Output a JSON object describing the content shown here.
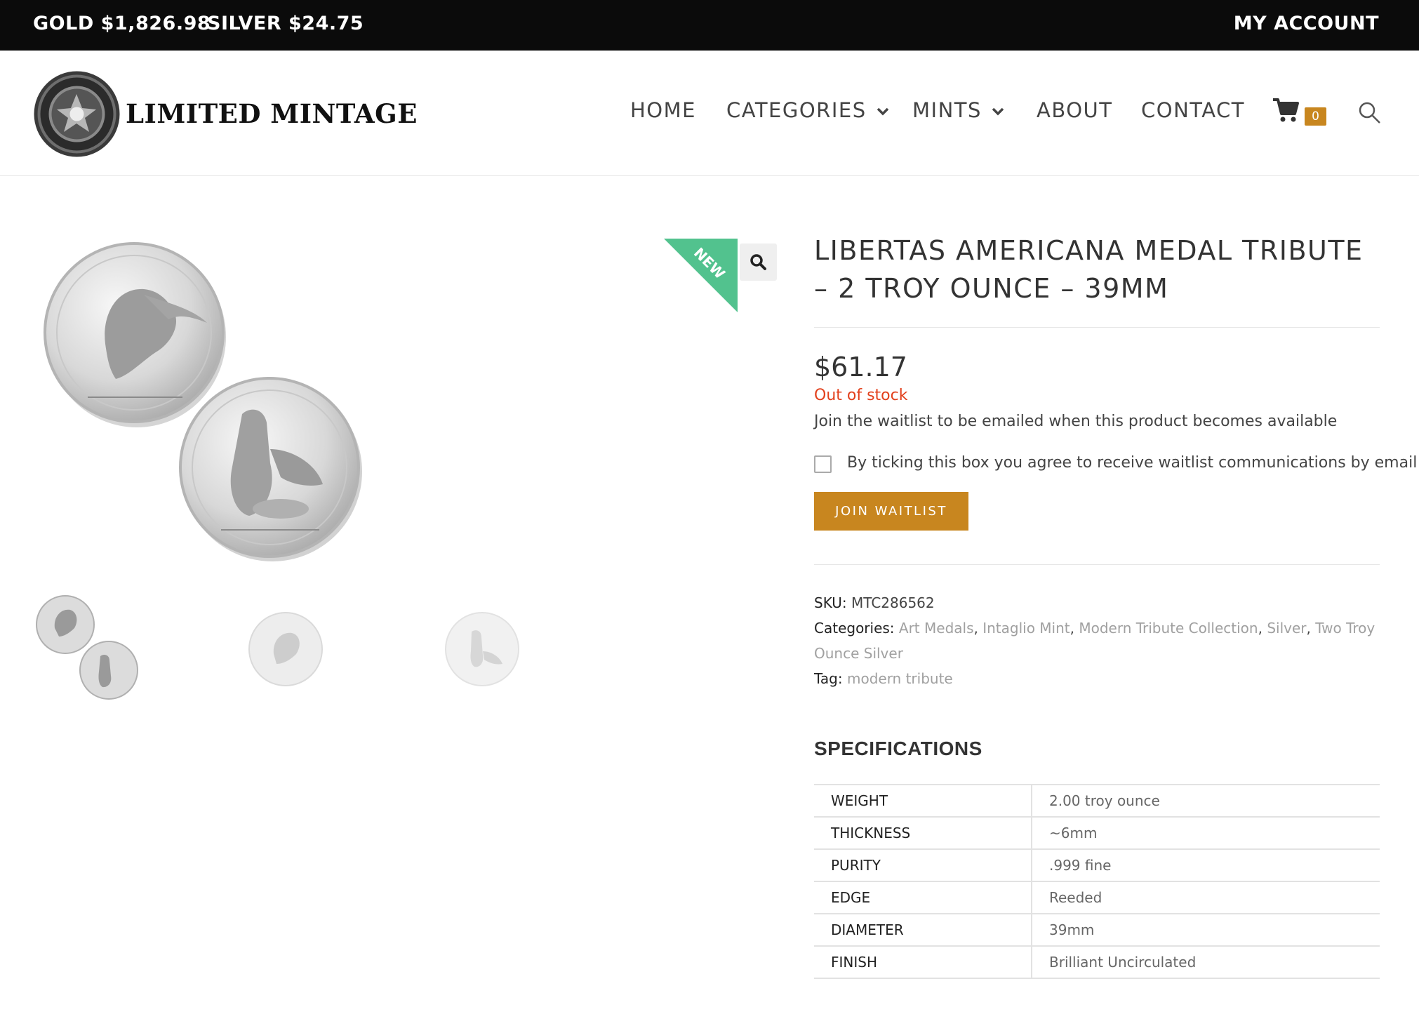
{
  "topbar": {
    "gold": "GOLD $1,826.98",
    "silver": "SILVER $24.75",
    "account": "MY ACCOUNT"
  },
  "header": {
    "brand": "LIMITED MINTAGE",
    "nav": {
      "home": "HOME",
      "categories": "CATEGORIES",
      "mints": "MINTS",
      "about": "ABOUT",
      "contact": "CONTACT"
    },
    "cart_count": "0"
  },
  "gallery": {
    "badge": "NEW"
  },
  "product": {
    "title": "LIBERTAS AMERICANA MEDAL TRIBUTE – 2 TROY OUNCE – 39MM",
    "price": "$61.17",
    "stock": "Out of stock",
    "waitlist_note": "Join the waitlist to be emailed when this product becomes available",
    "consent_label": "By ticking this box you agree to receive waitlist communications by email",
    "join_label": "JOIN WAITLIST",
    "sku_label": "SKU:",
    "sku": "MTC286562",
    "categories_label": "Categories:",
    "categories": [
      "Art Medals",
      "Intaglio Mint",
      "Modern Tribute Collection",
      "Silver",
      "Two Troy Ounce Silver"
    ],
    "tag_label": "Tag:",
    "tag": "modern tribute"
  },
  "specifications": {
    "title": "SPECIFICATIONS",
    "rows": [
      {
        "label": "WEIGHT",
        "value": "2.00 troy ounce"
      },
      {
        "label": "THICKNESS",
        "value": "~6mm"
      },
      {
        "label": "PURITY",
        "value": ".999 fine"
      },
      {
        "label": "EDGE",
        "value": "Reeded"
      },
      {
        "label": "DIAMETER",
        "value": "39mm"
      },
      {
        "label": "FINISH",
        "value": "Brilliant Uncirculated"
      }
    ]
  },
  "colors": {
    "accent": "#c8861f",
    "badge": "#52c28e",
    "out_of_stock": "#e2401c",
    "topbar": "#0b0b0b"
  },
  "icons": [
    "logo-seal",
    "chevron-down-icon",
    "cart-icon",
    "search-icon",
    "zoom-icon"
  ]
}
